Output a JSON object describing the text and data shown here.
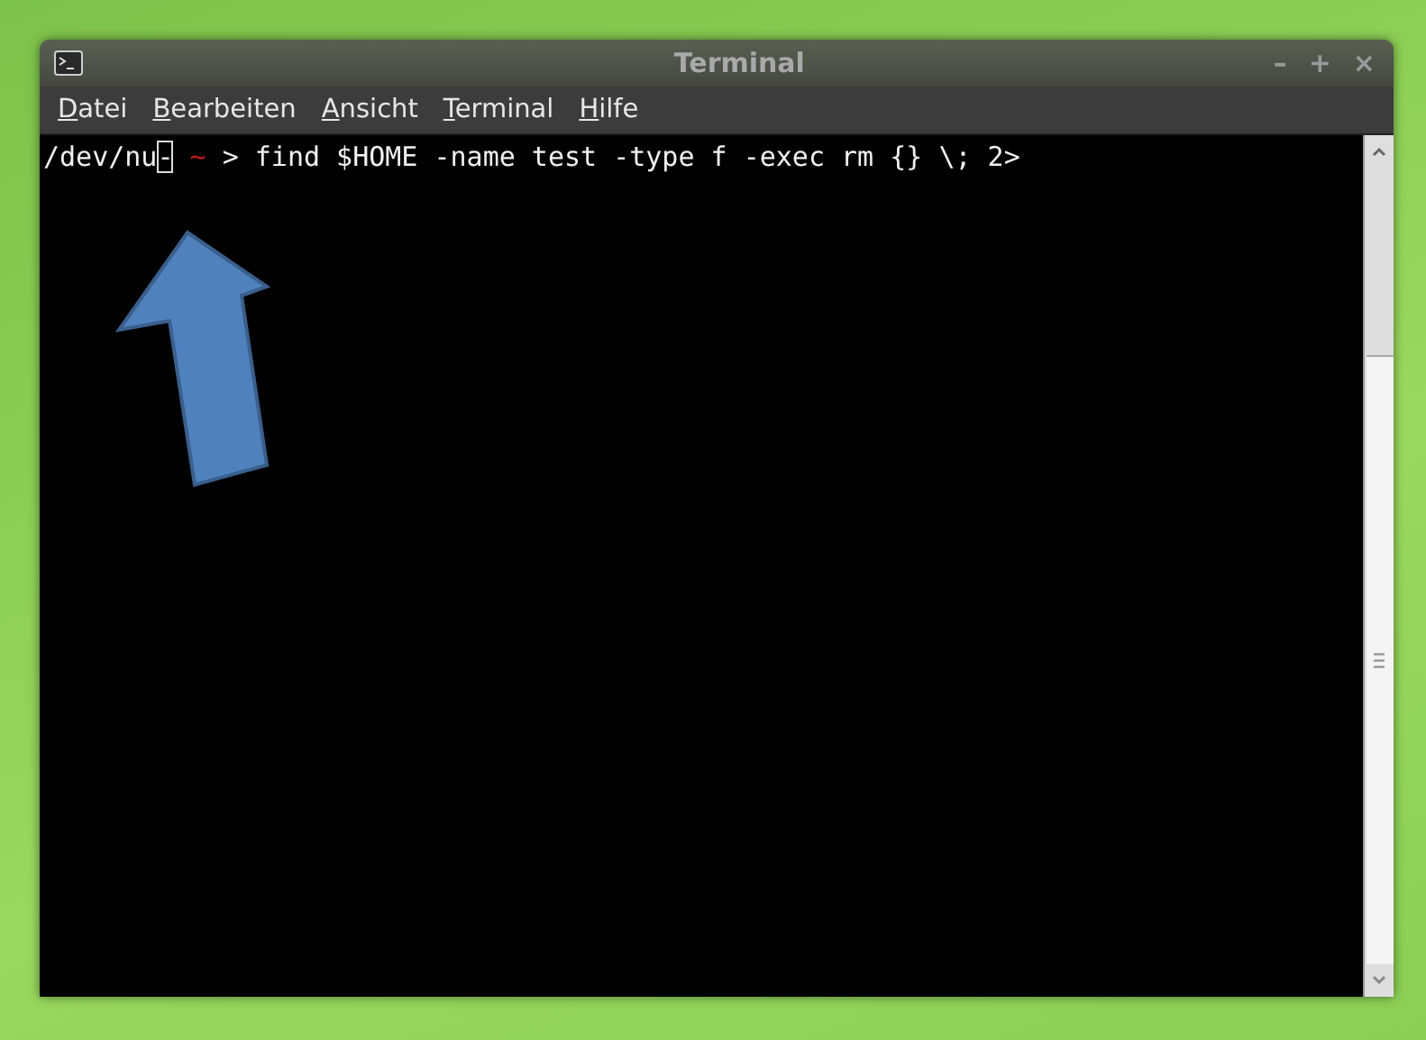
{
  "window": {
    "title": "Terminal",
    "controls": [
      "–",
      "+",
      "×"
    ]
  },
  "menu": [
    {
      "label": "Datei"
    },
    {
      "label": "Bearbeiten"
    },
    {
      "label": "Ansicht"
    },
    {
      "label": "Terminal"
    },
    {
      "label": "Hilfe"
    }
  ],
  "terminal": {
    "lines": [
      {
        "segments": [
          {
            "kind": "text",
            "text": "/dev/nu"
          },
          {
            "kind": "cursor",
            "text": "-"
          },
          {
            "kind": "colored",
            "text": " ~ ",
            "color": "#c01818"
          },
          {
            "kind": "text",
            "text": "> find $HOME -name test -type f -exec rm {} \\; 2>"
          }
        ]
      }
    ]
  }
}
